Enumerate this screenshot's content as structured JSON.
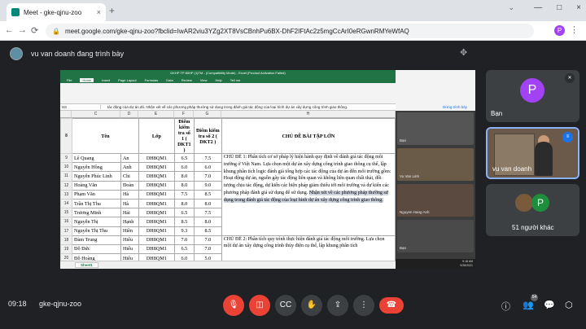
{
  "browser": {
    "tab_title": "Meet - gke-qjnu-zoo",
    "tab_close": "×",
    "new_tab": "+",
    "tab_dropdown": "⌄",
    "window_controls": [
      "—",
      "□",
      "×"
    ],
    "url": "meet.google.com/gke-qjnu-zoo?fbclid=IwAR2viu3YZg2XT8VsCBnhPu6BX-DhF2IFtAc2z5mgCcArI0eRGwnRMYeWfAQ",
    "profile_initial": "P",
    "nav_back": "←",
    "nav_forward": "→",
    "nav_reload": "⟳"
  },
  "presenter": {
    "name": "vu van doanh đang trình bày",
    "pin_icon": "pin-icon"
  },
  "excel": {
    "title": "DKHP TP 80HP (1)TM - (Compatibility Mode) - Excel (Product Activation Failed)",
    "menu": [
      "File",
      "Home",
      "Insert",
      "Page Layout",
      "Formulas",
      "Data",
      "Review",
      "View",
      "Help",
      "Tell me"
    ],
    "namebox": "H3",
    "formula": "tác động của dự án đó. Nhận xét về các phương pháp thường sử dụng trong đánh giá tác động của loại hình dự án xây dựng công trình giao thông.",
    "columns": [
      "",
      "C",
      "D",
      "E",
      "F",
      "G",
      "H"
    ],
    "header_row": {
      "rn": "8",
      "ten": "Tên",
      "lop": "Lớp",
      "dkt1": "Điểm kiểm tra số 1 ( DKT1 )",
      "dkt2": "Điểm kiểm tra số 2 ( DKT2 )",
      "topic": "CHỦ ĐỀ BÀI TẬP LỚN"
    },
    "rows": [
      {
        "rn": "9",
        "ho": "Lê Quang",
        "ten": "An",
        "lop": "DH8QM1",
        "d1": "6.5",
        "d2": "7.5"
      },
      {
        "rn": "10",
        "ho": "Nguyễn Hồng",
        "ten": "Anh",
        "lop": "DH8QM1",
        "d1": "6.0",
        "d2": "6.0"
      },
      {
        "rn": "11",
        "ho": "Nguyễn Phúc Linh",
        "ten": "Chi",
        "lop": "DH8QM1",
        "d1": "8.0",
        "d2": "7.0"
      },
      {
        "rn": "12",
        "ho": "Hoàng Văn",
        "ten": "Đoàn",
        "lop": "DH8QM1",
        "d1": "8.0",
        "d2": "9.0"
      },
      {
        "rn": "13",
        "ho": "Phạm Văn",
        "ten": "Hà",
        "lop": "DH8QM1",
        "d1": "7.5",
        "d2": "8.5"
      },
      {
        "rn": "14",
        "ho": "Trần Thị Thu",
        "ten": "Hà",
        "lop": "DH8QM1",
        "d1": "8.0",
        "d2": "8.0"
      },
      {
        "rn": "15",
        "ho": "Trương Minh",
        "ten": "Hải",
        "lop": "DH8QM1",
        "d1": "6.5",
        "d2": "7.5"
      },
      {
        "rn": "16",
        "ho": "Nguyễn Thị",
        "ten": "Hạnh",
        "lop": "DH8QM1",
        "d1": "8.5",
        "d2": "8.0"
      },
      {
        "rn": "17",
        "ho": "Nguyễn Thị Thu",
        "ten": "Hiền",
        "lop": "DH8QM1",
        "d1": "9.3",
        "d2": "8.5"
      },
      {
        "rn": "18",
        "ho": "Đàm Trung",
        "ten": "Hiếu",
        "lop": "DH8QM1",
        "d1": "7.0",
        "d2": "7.0"
      },
      {
        "rn": "19",
        "ho": "Đỗ Đức",
        "ten": "Hiếu",
        "lop": "DH8QM1",
        "d1": "6.5",
        "d2": "7.0"
      },
      {
        "rn": "20",
        "ho": "Đỗ Hoàng",
        "ten": "Hiếu",
        "lop": "DH8QM1",
        "d1": "6.0",
        "d2": "5.0"
      }
    ],
    "topic1_text": "CHỦ ĐỀ 1: Phân tích cơ sở pháp lý hiện hành quy định về đánh giá tác động môi trường ở Việt Nam. Lựa chọn một dự án xây dựng công trình giao thông cụ thể, lập khung phân tích logic đánh giá tổng hợp các tác động của dự án đến môi trường gồm: Hoạt động dự án, nguồn gây tác động liên quan và không liên quan chất thải, đối tượng chịu tác động, dự kiến các biện pháp giảm thiểu tới môi trường và dự kiến các phương pháp đánh giá sử dụng để sử dụng.",
    "topic1_highlight": "Nhận xét về các phương pháp thường sử dụng trong đánh giá tác động của loại hình dự án xây dựng công trình giao thông.",
    "topic2_text": "CHỦ ĐỀ 2: Phân tích quy trình thực hiện đánh giá tác động môi trường. Lựa chọn một dự án xây dựng công trình thủy điện cụ thể, lập khung phân tích",
    "sheet_tab": "Sheet1",
    "present_label": "Dừng trình bày",
    "inner_names": [
      "Bạn",
      "Vu Van Linh",
      "Nguyen Hang Anh",
      "Bạn"
    ],
    "taskbar_time": "9:18 AM",
    "taskbar_date": "9/28/2021"
  },
  "tiles": {
    "you_initial": "P",
    "you_label": "Bạn",
    "presenter_label": "vu van doanh",
    "others_label": "51 người khác",
    "others_initial": "P"
  },
  "controls": {
    "time": "09:18",
    "meeting_code": "gke-qjnu-zoo",
    "people_count": "54"
  },
  "colors": {
    "excel_green": "#217346",
    "meet_bg": "#202124",
    "end_call_red": "#ea4335",
    "avatar_purple": "#a142f4",
    "avatar_green": "#1e8e3e"
  }
}
